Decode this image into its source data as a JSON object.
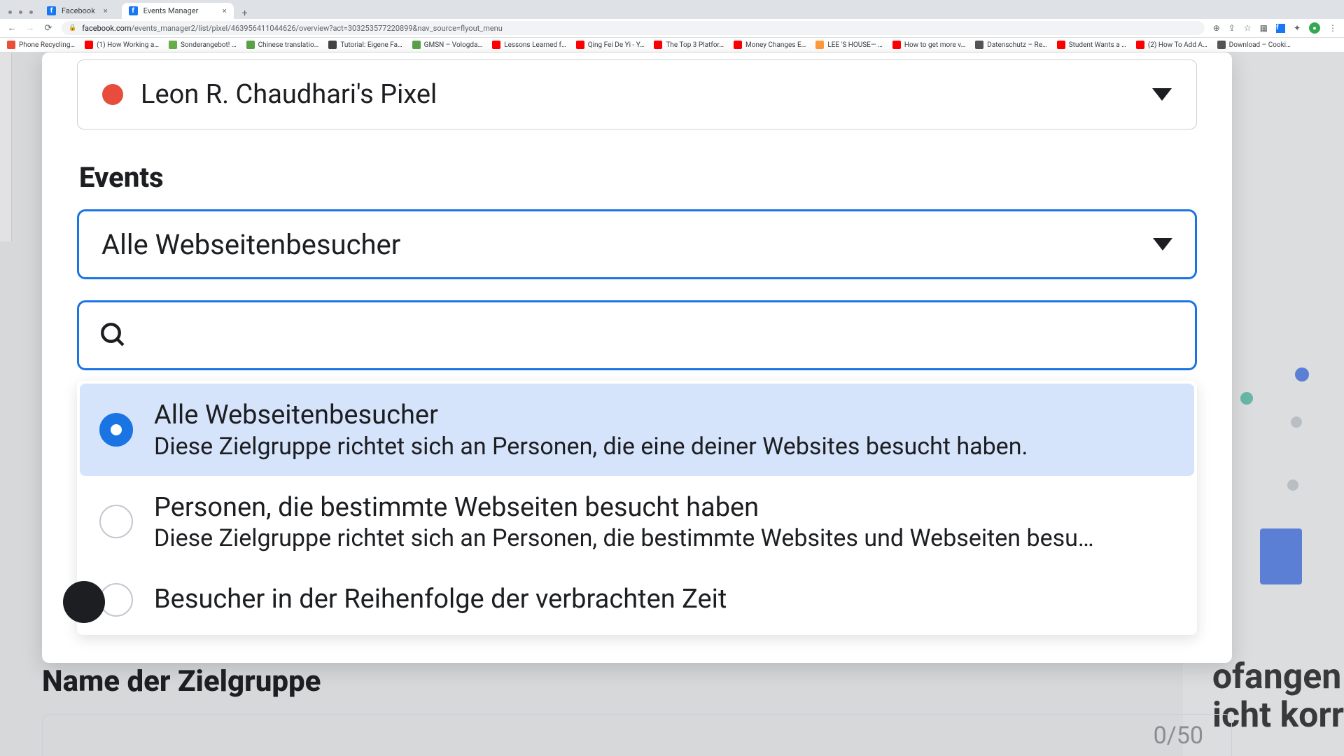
{
  "browser": {
    "tabs": [
      {
        "title": "Facebook",
        "active": false
      },
      {
        "title": "Events Manager",
        "active": true
      }
    ],
    "url_host": "facebook.com",
    "url_path": "/events_manager2/list/pixel/463956411044626/overview?act=303253577220899&nav_source=flyout_menu",
    "bookmarks": [
      {
        "label": "Phone Recycling…",
        "color": "#e8503a"
      },
      {
        "label": "(1) How Working a…",
        "color": "#ff0000"
      },
      {
        "label": "Sonderangebot! …",
        "color": "#67b04b"
      },
      {
        "label": "Chinese translatio…",
        "color": "#5aa34a"
      },
      {
        "label": "Tutorial: Eigene Fa…",
        "color": "#444"
      },
      {
        "label": "GMSN – Vologda…",
        "color": "#5aa34a"
      },
      {
        "label": "Lessons Learned f…",
        "color": "#ff0000"
      },
      {
        "label": "Qing Fei De Yi - Y…",
        "color": "#ff0000"
      },
      {
        "label": "The Top 3 Platfor…",
        "color": "#ff0000"
      },
      {
        "label": "Money Changes E…",
        "color": "#ff0000"
      },
      {
        "label": "LEE 'S HOUSE— …",
        "color": "#ff9c3b"
      },
      {
        "label": "How to get more v…",
        "color": "#ff0000"
      },
      {
        "label": "Datenschutz – Re…",
        "color": "#555"
      },
      {
        "label": "Student Wants a …",
        "color": "#ff0000"
      },
      {
        "label": "(2) How To Add A…",
        "color": "#ff0000"
      },
      {
        "label": "Download – Cooki…",
        "color": "#555"
      }
    ]
  },
  "pixel": {
    "name": "Leon R. Chaudhari's Pixel"
  },
  "sections": {
    "events": "Events",
    "audience_name": "Name der Zielgruppe"
  },
  "events_select": {
    "value": "Alle Webseitenbesucher"
  },
  "search": {
    "placeholder": ""
  },
  "options": [
    {
      "title": "Alle Webseitenbesucher",
      "desc": "Diese Zielgruppe richtet sich an Personen, die eine deiner Websites besucht haben.",
      "selected": true
    },
    {
      "title": "Personen, die bestimmte Webseiten besucht haben",
      "desc": "Diese Zielgruppe richtet sich an Personen, die bestimmte Websites und Webseiten besu…",
      "selected": false
    },
    {
      "title": "Besucher in der Reihenfolge der verbrachten Zeit",
      "desc": "",
      "selected": false
    }
  ],
  "counter": "0/50",
  "bg_text1": "ofangen",
  "bg_text2": "icht korr"
}
